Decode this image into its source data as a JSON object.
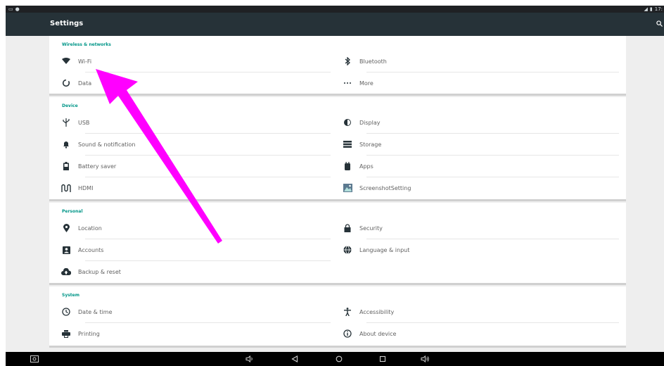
{
  "app": {
    "title": "Settings"
  },
  "status": {
    "time": "17:"
  },
  "colors": {
    "accent": "#009688",
    "appbar": "#263238",
    "icon": "#263238",
    "annotation": "#ff00ff"
  },
  "sections": [
    {
      "title": "Wireless & networks",
      "items": [
        {
          "label": "Wi-Fi",
          "icon": "wifi-icon"
        },
        {
          "label": "Bluetooth",
          "icon": "bluetooth-icon"
        },
        {
          "label": "Data",
          "icon": "data-usage-icon"
        },
        {
          "label": "More",
          "icon": "more-icon"
        }
      ]
    },
    {
      "title": "Device",
      "items": [
        {
          "label": "USB",
          "icon": "usb-icon"
        },
        {
          "label": "Display",
          "icon": "display-icon"
        },
        {
          "label": "Sound & notification",
          "icon": "bell-icon"
        },
        {
          "label": "Storage",
          "icon": "storage-icon"
        },
        {
          "label": "Battery saver",
          "icon": "battery-icon"
        },
        {
          "label": "Apps",
          "icon": "apps-icon"
        },
        {
          "label": "HDMI",
          "icon": "hdmi-icon"
        },
        {
          "label": "ScreenshotSetting",
          "icon": "screenshot-icon"
        }
      ]
    },
    {
      "title": "Personal",
      "items": [
        {
          "label": "Location",
          "icon": "location-icon"
        },
        {
          "label": "Security",
          "icon": "lock-icon"
        },
        {
          "label": "Accounts",
          "icon": "account-icon"
        },
        {
          "label": "Language & input",
          "icon": "globe-icon"
        },
        {
          "label": "Backup & reset",
          "icon": "cloud-backup-icon"
        }
      ]
    },
    {
      "title": "System",
      "items": [
        {
          "label": "Date & time",
          "icon": "clock-icon"
        },
        {
          "label": "Accessibility",
          "icon": "accessibility-icon"
        },
        {
          "label": "Printing",
          "icon": "printer-icon"
        },
        {
          "label": "About device",
          "icon": "info-icon"
        }
      ]
    }
  ]
}
